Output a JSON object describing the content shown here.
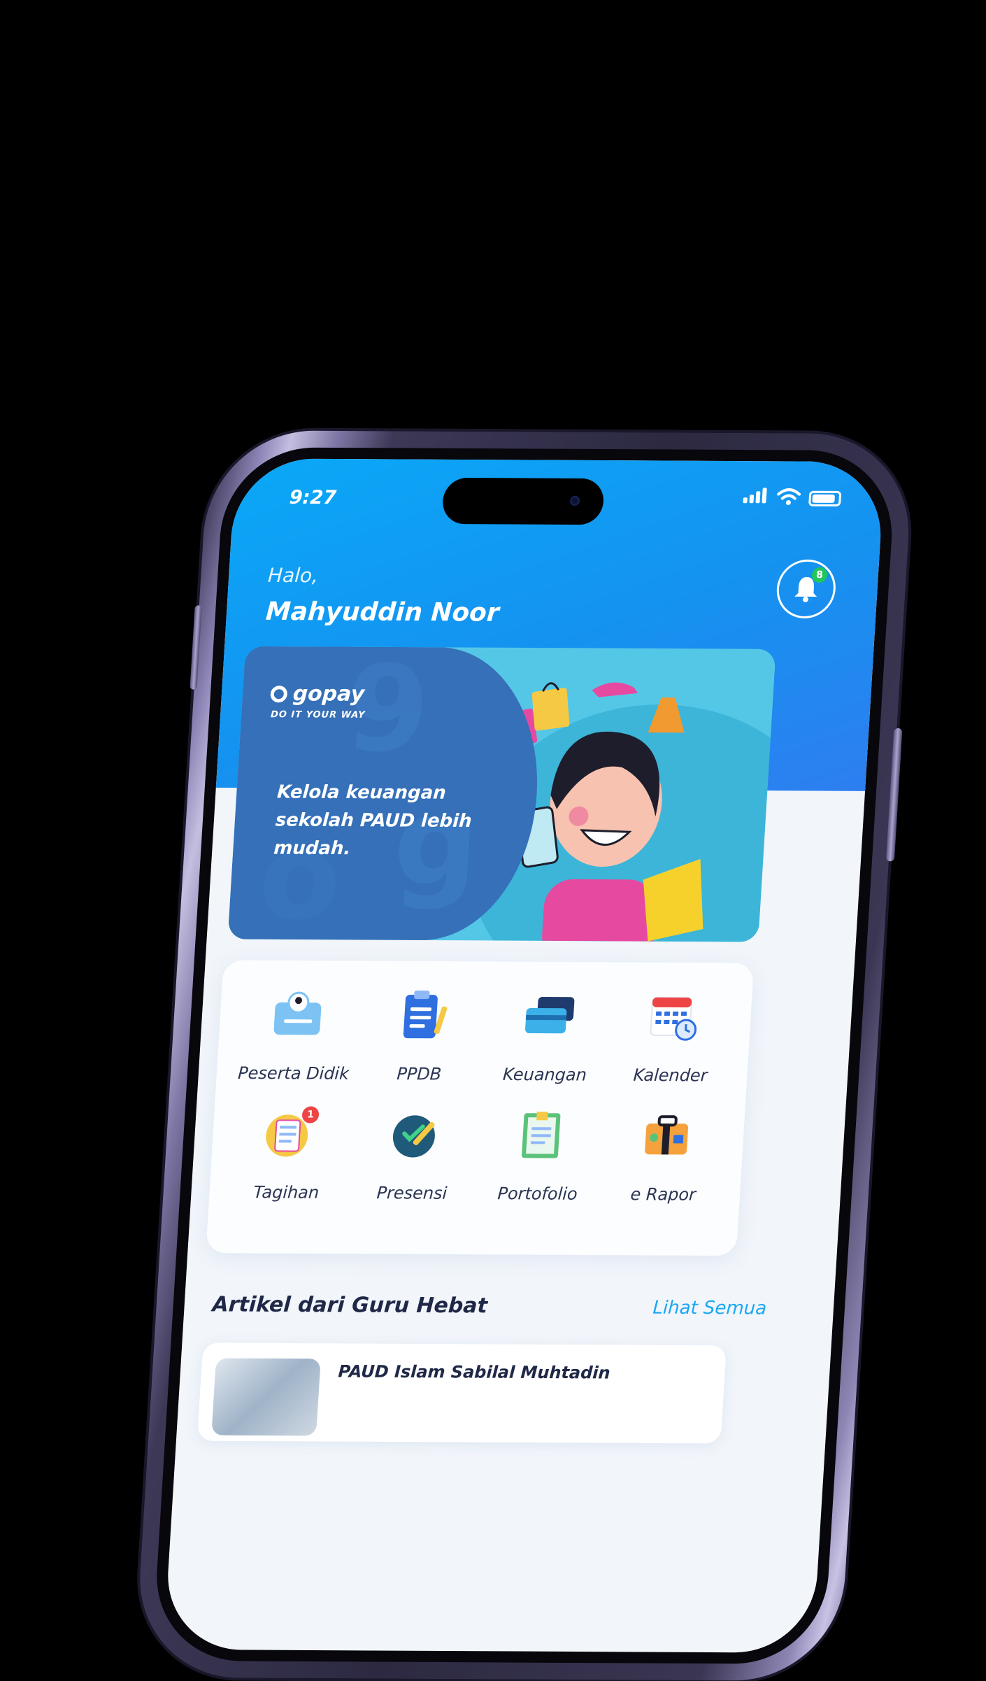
{
  "status_bar": {
    "time": "9:27"
  },
  "header": {
    "greeting": "Halo,",
    "user_name": "Mahyuddin Noor",
    "notification_count": "8"
  },
  "banner": {
    "brand": "gopay",
    "tagline": "DO IT YOUR WAY",
    "text": "Kelola keuangan sekolah PAUD lebih mudah."
  },
  "menu": {
    "items": [
      {
        "label": "Peserta Didik",
        "icon": "student-card-icon"
      },
      {
        "label": "PPDB",
        "icon": "clipboard-icon"
      },
      {
        "label": "Keuangan",
        "icon": "cards-icon"
      },
      {
        "label": "Kalender",
        "icon": "calendar-icon"
      },
      {
        "label": "Tagihan",
        "icon": "bill-icon",
        "badge": "1"
      },
      {
        "label": "Presensi",
        "icon": "attendance-icon"
      },
      {
        "label": "Portofolio",
        "icon": "portfolio-icon"
      },
      {
        "label": "e Rapor",
        "icon": "report-icon"
      }
    ]
  },
  "articles": {
    "section_title": "Artikel dari Guru Hebat",
    "see_all": "Lihat Semua",
    "items": [
      {
        "title": "PAUD Islam Sabilal Muhtadin"
      }
    ]
  },
  "colors": {
    "header_blue": "#0aa8f7",
    "banner_dark": "#3570b8",
    "accent_link": "#1ba7f2",
    "badge_green": "#22c55e",
    "badge_red": "#ef4444"
  }
}
